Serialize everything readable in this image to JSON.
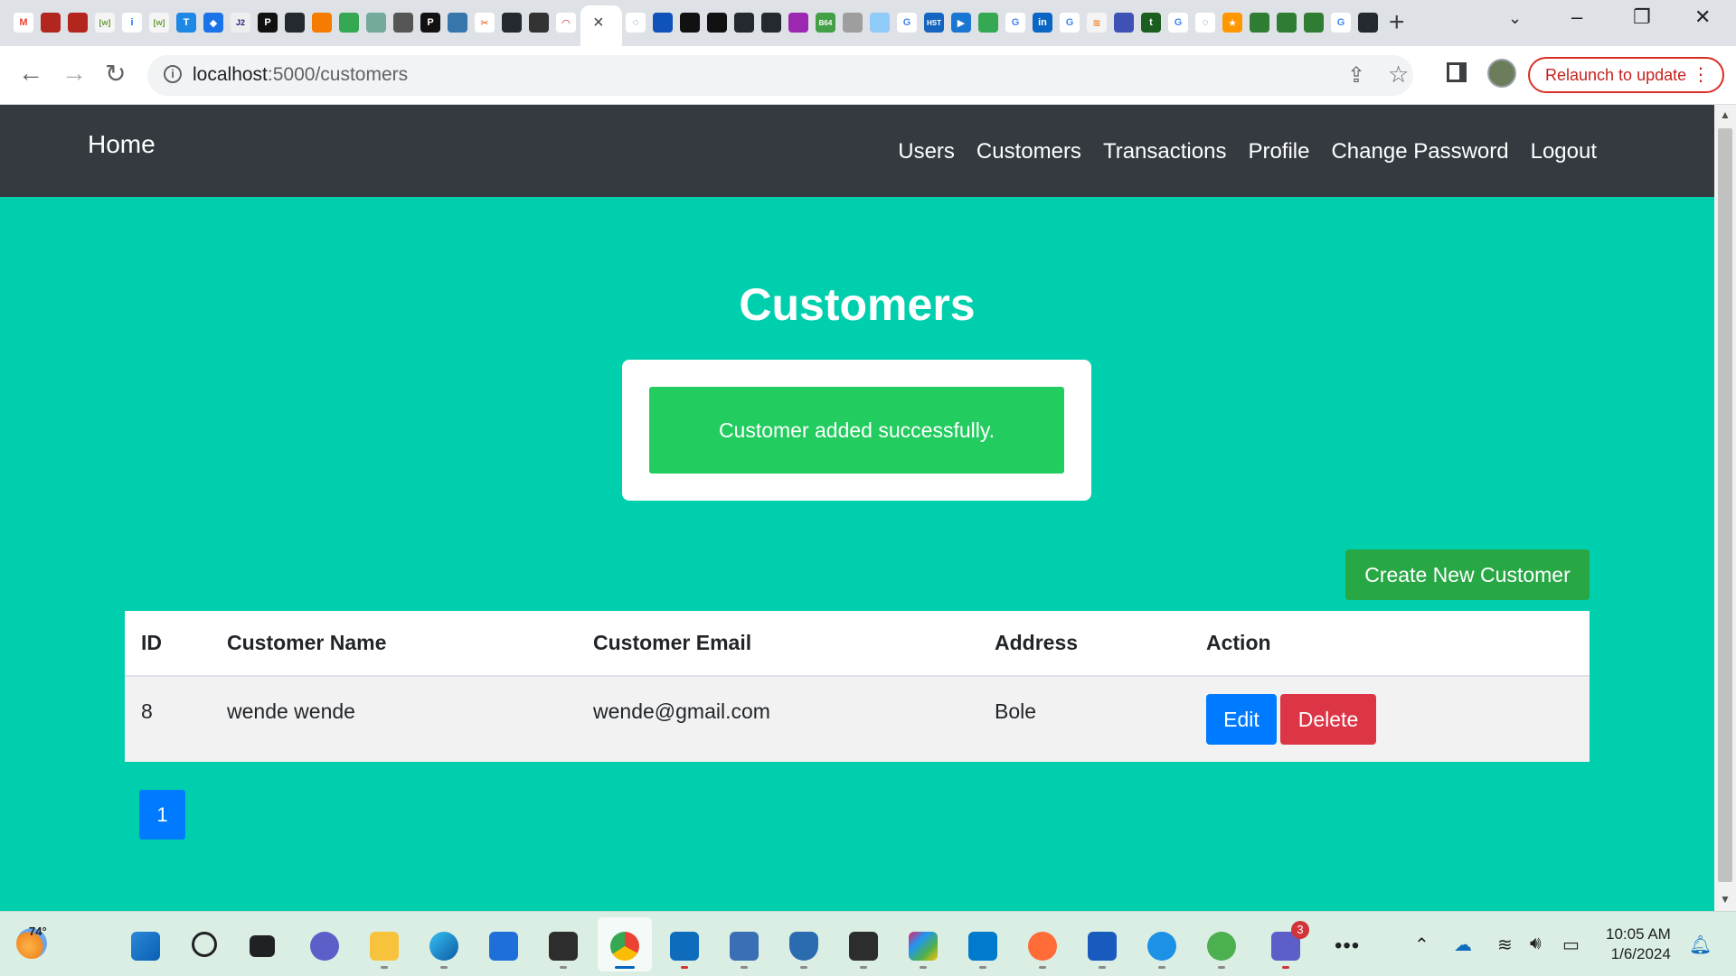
{
  "browser": {
    "tab_close_glyph": "×",
    "new_tab_glyph": "+",
    "url_host": "localhost",
    "url_path": ":5000/customers",
    "relaunch_label": "Relaunch to update"
  },
  "navbar": {
    "brand": "Home",
    "links": [
      "Users",
      "Customers",
      "Transactions",
      "Profile",
      "Change Password",
      "Logout"
    ]
  },
  "page": {
    "title": "Customers",
    "flash_message": "Customer added successfully.",
    "create_button": "Create New Customer"
  },
  "table": {
    "headers": [
      "ID",
      "Customer Name",
      "Customer Email",
      "Address",
      "Action"
    ],
    "rows": [
      {
        "id": "8",
        "name": "wende wende",
        "email": "wende@gmail.com",
        "address": "Bole",
        "edit": "Edit",
        "delete": "Delete"
      }
    ]
  },
  "pagination": {
    "current_page": "1"
  },
  "taskbar": {
    "weather_temp": "74°",
    "teams_badge": "3",
    "time": "10:05 AM",
    "date": "1/6/2024"
  },
  "colors": {
    "page_bg": "#00cfad",
    "navbar_bg": "#343a40",
    "alert_bg": "#22cc5e",
    "create_button": "#28a745",
    "edit_button": "#007bff",
    "delete_button": "#dc3545"
  }
}
